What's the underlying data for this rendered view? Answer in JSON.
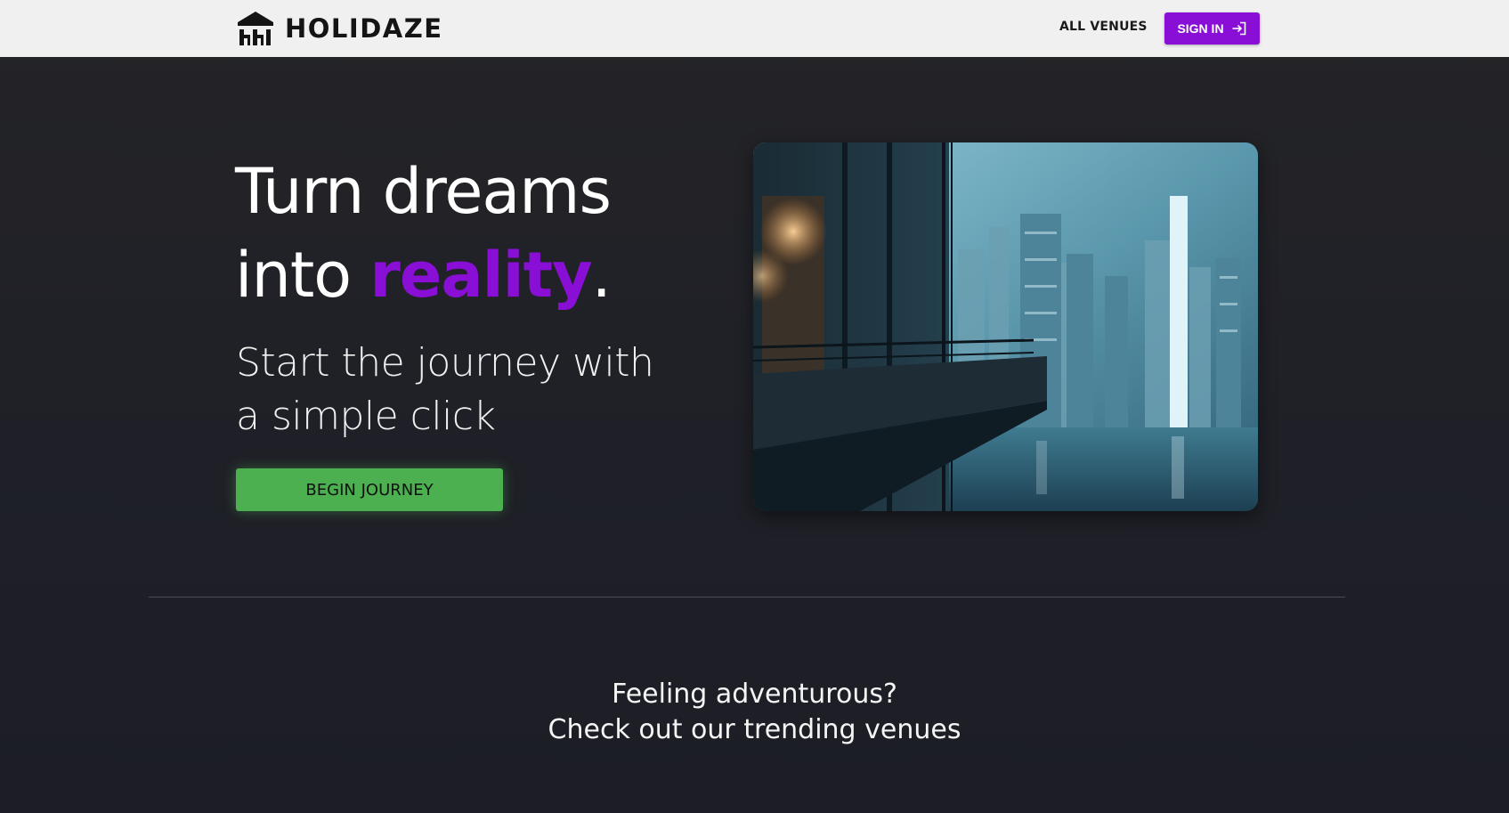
{
  "header": {
    "brand_name": "HOLIDAZE",
    "logo_icon": "house-columns-icon",
    "nav_all_venues": "ALL VENUES",
    "sign_in_label": "SIGN IN",
    "sign_in_icon": "sign-in-arrow-icon",
    "sign_in_color": "#8a0fd6"
  },
  "hero": {
    "title_line1": "Turn dreams",
    "title_line2_pre": "into ",
    "title_accent": "reality",
    "title_period": ".",
    "subtitle_line1": "Start the journey with",
    "subtitle_line2": "a simple click",
    "cta_label": "BEGIN JOURNEY",
    "cta_color": "#4caf50",
    "accent_color": "#8a0fd6"
  },
  "trending": {
    "line1": "Feeling adventurous?",
    "line2": "Check out our trending venues"
  }
}
